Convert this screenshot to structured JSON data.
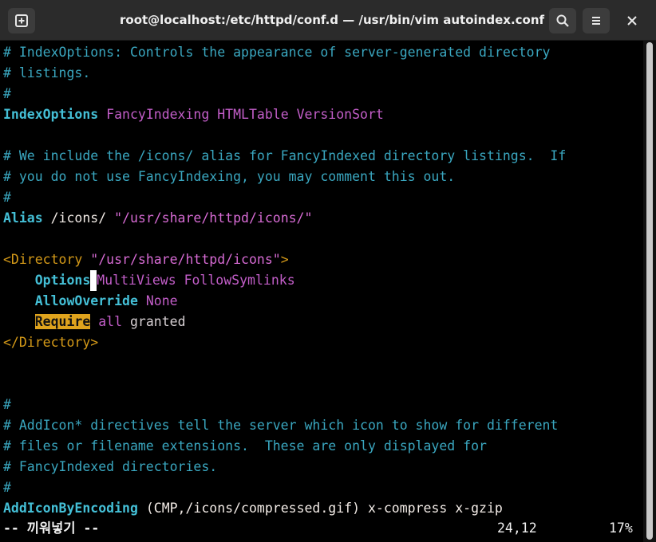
{
  "window": {
    "title": "root@localhost:/etc/httpd/conf.d — /usr/bin/vim autoindex.conf",
    "buttons": [
      "new-tab-icon",
      "search-icon",
      "menu-icon",
      "close-icon"
    ]
  },
  "editor": {
    "lines": [
      {
        "spans": [
          {
            "t": "# IndexOptions: Controls the appearance of server-generated directory",
            "s": "c"
          }
        ]
      },
      {
        "spans": [
          {
            "t": "# listings.",
            "s": "c"
          }
        ]
      },
      {
        "spans": [
          {
            "t": "#",
            "s": "c"
          }
        ]
      },
      {
        "spans": [
          {
            "t": "IndexOptions",
            "s": "k"
          },
          {
            "t": " FancyIndexing HTMLTable VersionSort",
            "s": "s"
          }
        ]
      },
      {
        "spans": [
          {
            "t": "",
            "s": "c"
          }
        ]
      },
      {
        "spans": [
          {
            "t": "# We include the /icons/ alias for FancyIndexed directory listings.  If",
            "s": "c"
          }
        ]
      },
      {
        "spans": [
          {
            "t": "# you do not use FancyIndexing, you may comment this out.",
            "s": "c"
          }
        ]
      },
      {
        "spans": [
          {
            "t": "#",
            "s": "c"
          }
        ]
      },
      {
        "spans": [
          {
            "t": "Alias",
            "s": "k"
          },
          {
            "t": " /icons/ ",
            "s": "t"
          },
          {
            "t": "\"/usr/share/httpd/icons/\"",
            "s": "q"
          }
        ]
      },
      {
        "spans": [
          {
            "t": "",
            "s": "c"
          }
        ]
      },
      {
        "spans": [
          {
            "t": "<Directory ",
            "s": "tag"
          },
          {
            "t": "\"/usr/share/httpd/icons\"",
            "s": "q"
          },
          {
            "t": ">",
            "s": "tag"
          }
        ]
      },
      {
        "spans": [
          {
            "t": "    ",
            "s": "t"
          },
          {
            "t": "Options",
            "s": "k"
          },
          {
            "t": " ",
            "s": "cursor"
          },
          {
            "t": "MultiViews FollowSymlinks",
            "s": "s"
          }
        ]
      },
      {
        "spans": [
          {
            "t": "    ",
            "s": "t"
          },
          {
            "t": "AllowOverride",
            "s": "k"
          },
          {
            "t": " None",
            "s": "s"
          }
        ]
      },
      {
        "spans": [
          {
            "t": "    ",
            "s": "t"
          },
          {
            "t": "Require",
            "s": "hl"
          },
          {
            "t": " all",
            "s": "s"
          },
          {
            "t": " granted",
            "s": "n"
          }
        ]
      },
      {
        "spans": [
          {
            "t": "</Directory>",
            "s": "tag"
          }
        ]
      },
      {
        "spans": [
          {
            "t": "",
            "s": "c"
          }
        ]
      },
      {
        "spans": [
          {
            "t": "",
            "s": "c"
          }
        ]
      },
      {
        "spans": [
          {
            "t": "#",
            "s": "c"
          }
        ]
      },
      {
        "spans": [
          {
            "t": "# AddIcon* directives tell the server which icon to show for different",
            "s": "c"
          }
        ]
      },
      {
        "spans": [
          {
            "t": "# files or filename extensions.  These are only displayed for",
            "s": "c"
          }
        ]
      },
      {
        "spans": [
          {
            "t": "# FancyIndexed directories.",
            "s": "c"
          }
        ]
      },
      {
        "spans": [
          {
            "t": "#",
            "s": "c"
          }
        ]
      },
      {
        "spans": [
          {
            "t": "AddIconByEncoding",
            "s": "k"
          },
          {
            "t": " (CMP,/icons/compressed.gif) x-compress x-gzip",
            "s": "t"
          }
        ]
      }
    ]
  },
  "status": {
    "mode": "-- 끼워넣기 --",
    "position": "24,12",
    "percent": "17%"
  },
  "colors": {
    "background": "#000000",
    "comment": "#3aa7c0",
    "keyword": "#44bfd6",
    "value": "#c35ec9",
    "string": "#d76bd4",
    "tag": "#d59a18",
    "highlight": "#dfa31d"
  }
}
